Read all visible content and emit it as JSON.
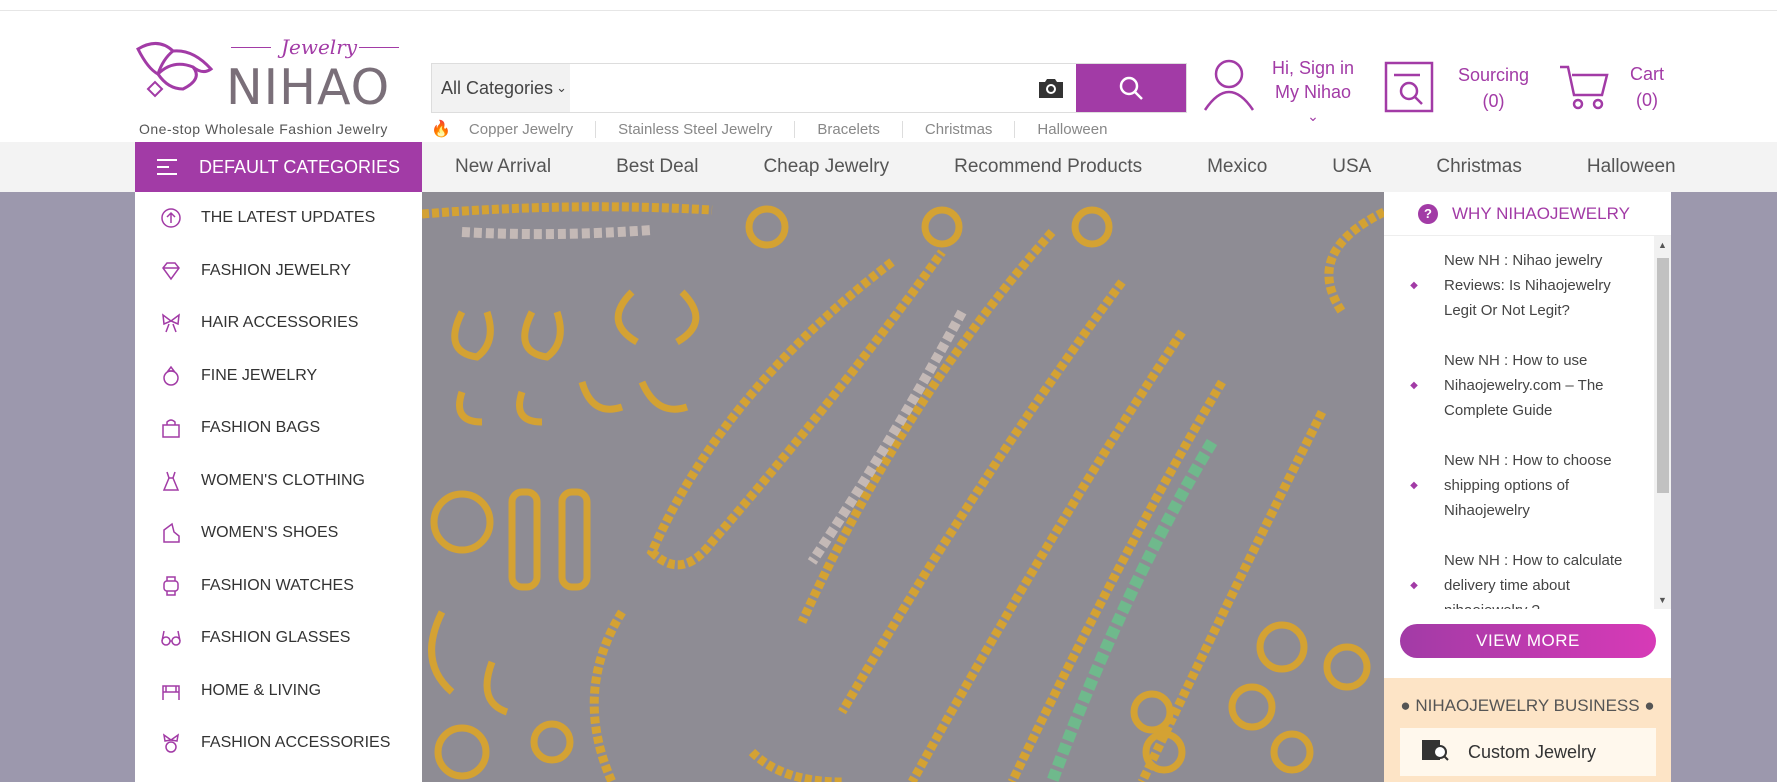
{
  "logo": {
    "brand": "NIHAO",
    "script": "Jewelry",
    "tagline": "One-stop Wholesale Fashion Jewelry"
  },
  "search": {
    "category": "All Categories",
    "placeholder": "",
    "camera_icon": "camera-icon",
    "search_icon": "search-icon"
  },
  "hot_links": [
    "Copper Jewelry",
    "Stainless Steel Jewelry",
    "Bracelets",
    "Christmas",
    "Halloween"
  ],
  "account": {
    "line1": "Hi, Sign in",
    "line2": "My Nihao"
  },
  "sourcing": {
    "label": "Sourcing",
    "count": "(0)"
  },
  "cart": {
    "label": "Cart",
    "count": "(0)"
  },
  "nav": {
    "categories_label": "DEFAULT CATEGORIES",
    "links": [
      "New Arrival",
      "Best Deal",
      "Cheap Jewelry",
      "Recommend Products",
      "Mexico",
      "USA",
      "Christmas",
      "Halloween"
    ]
  },
  "side_menu": [
    {
      "label": "THE LATEST UPDATES",
      "icon": "arrow-up-circle-icon"
    },
    {
      "label": "FASHION JEWELRY",
      "icon": "diamond-icon"
    },
    {
      "label": "HAIR ACCESSORIES",
      "icon": "bow-icon"
    },
    {
      "label": "FINE JEWELRY",
      "icon": "ring-icon"
    },
    {
      "label": "FASHION BAGS",
      "icon": "bag-icon"
    },
    {
      "label": "WOMEN'S CLOTHING",
      "icon": "dress-icon"
    },
    {
      "label": "WOMEN'S SHOES",
      "icon": "shoe-icon"
    },
    {
      "label": "FASHION WATCHES",
      "icon": "watch-icon"
    },
    {
      "label": "FASHION GLASSES",
      "icon": "glasses-icon"
    },
    {
      "label": "HOME & LIVING",
      "icon": "sofa-icon"
    },
    {
      "label": "FASHION ACCESSORIES",
      "icon": "accessory-icon"
    }
  ],
  "why": {
    "title": "WHY NIHAOJEWELRY",
    "news": [
      "New NH : Nihao jewelry Reviews: Is Nihaojewelry Legit Or Not Legit?",
      "New NH : How to use Nihaojewelry.com – The Complete Guide",
      "New NH : How to choose shipping options of Nihaojewelry",
      "New NH : How to calculate delivery time about nihaojewelry ?"
    ],
    "view_more": "VIEW MORE"
  },
  "business": {
    "title": "● NIHAOJEWELRY BUSINESS ●",
    "custom": "Custom Jewelry"
  },
  "colors": {
    "brand": "#a23ba6",
    "nav_bg": "#f3f3f3",
    "business_bg": "#fde4c6"
  }
}
